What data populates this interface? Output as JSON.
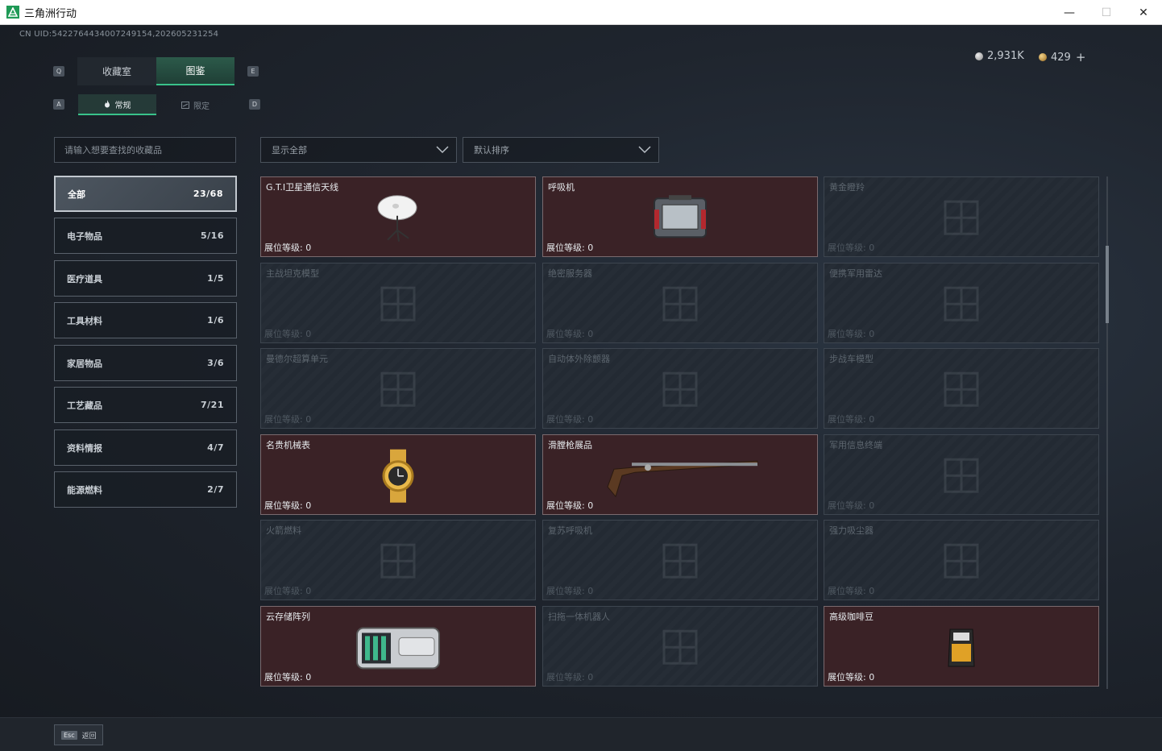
{
  "window": {
    "title": "三角洲行动",
    "minimize": "—",
    "maximize": "☐",
    "close": "✕"
  },
  "uid": "CN UID:5422764434007249154,202605231254",
  "currency": {
    "silver": "2,931K",
    "gold": "429",
    "plus": "+"
  },
  "tabs": {
    "key_left": "Q",
    "key_right": "E",
    "items": [
      {
        "label": "收藏室"
      },
      {
        "label": "图鉴"
      }
    ]
  },
  "subtabs": {
    "key_left": "A",
    "key_right": "D",
    "items": [
      {
        "label": "常规"
      },
      {
        "label": "限定"
      }
    ]
  },
  "search": {
    "placeholder": "请输入想要查找的收藏品"
  },
  "filters": {
    "show": "显示全部",
    "sort": "默认排序"
  },
  "categories": [
    {
      "label": "全部",
      "count": "23/68"
    },
    {
      "label": "电子物品",
      "count": "5/16"
    },
    {
      "label": "医疗道具",
      "count": "1/5"
    },
    {
      "label": "工具材料",
      "count": "1/6"
    },
    {
      "label": "家居物品",
      "count": "3/6"
    },
    {
      "label": "工艺藏品",
      "count": "7/21"
    },
    {
      "label": "资料情报",
      "count": "4/7"
    },
    {
      "label": "能源燃料",
      "count": "2/7"
    }
  ],
  "grid": {
    "level_label": "展位等级: 0",
    "items": [
      {
        "name": "G.T.I卫星通信天线",
        "unlocked": true,
        "icon": "satellite-dish-icon"
      },
      {
        "name": "呼吸机",
        "unlocked": true,
        "icon": "ventilator-icon"
      },
      {
        "name": "黄金瞪羚",
        "unlocked": false,
        "icon": "gazelle-statue-icon"
      },
      {
        "name": "主战坦克模型",
        "unlocked": false,
        "icon": "tank-model-icon"
      },
      {
        "name": "绝密服务器",
        "unlocked": false,
        "icon": "server-icon"
      },
      {
        "name": "便携军用雷达",
        "unlocked": false,
        "icon": "radar-icon"
      },
      {
        "name": "曼德尔超算单元",
        "unlocked": false,
        "icon": "supercomputer-icon"
      },
      {
        "name": "自动体外除颤器",
        "unlocked": false,
        "icon": "defibrillator-icon"
      },
      {
        "name": "步战车模型",
        "unlocked": false,
        "icon": "ifv-model-icon"
      },
      {
        "name": "名贵机械表",
        "unlocked": true,
        "icon": "watch-icon"
      },
      {
        "name": "滑膛枪展品",
        "unlocked": true,
        "icon": "musket-icon"
      },
      {
        "name": "军用信息终端",
        "unlocked": false,
        "icon": "terminal-icon"
      },
      {
        "name": "火箭燃料",
        "unlocked": false,
        "icon": "rocket-fuel-icon"
      },
      {
        "name": "复苏呼吸机",
        "unlocked": false,
        "icon": "resuscitator-icon"
      },
      {
        "name": "强力吸尘器",
        "unlocked": false,
        "icon": "vacuum-icon"
      },
      {
        "name": "云存储阵列",
        "unlocked": true,
        "icon": "storage-array-icon"
      },
      {
        "name": "扫拖一体机器人",
        "unlocked": false,
        "icon": "robot-vacuum-icon"
      },
      {
        "name": "高级咖啡豆",
        "unlocked": true,
        "icon": "coffee-beans-icon"
      }
    ]
  },
  "bottom": {
    "esc_key": "Esc",
    "back_label": "返回"
  },
  "colors": {
    "accent": "#39c28a",
    "unlocked_card": "#3a2226",
    "locked_card": "#232a33"
  }
}
